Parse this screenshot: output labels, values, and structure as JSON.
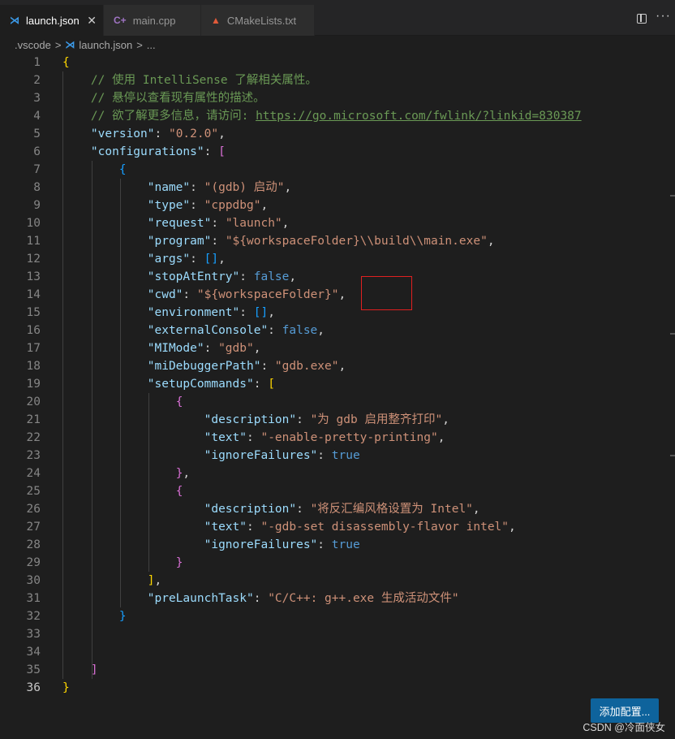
{
  "tabs": [
    {
      "label": "launch.json",
      "icon": "json-icon",
      "active": true,
      "close": "✕"
    },
    {
      "label": "main.cpp",
      "icon": "cpp-icon",
      "active": false
    },
    {
      "label": "CMakeLists.txt",
      "icon": "cmake-icon",
      "active": false
    }
  ],
  "breadcrumb": {
    "folder": ".vscode",
    "sep": ">",
    "file": "launch.json",
    "tail": "..."
  },
  "editor": {
    "line_numbers": [
      "1",
      "2",
      "3",
      "4",
      "5",
      "6",
      "7",
      "8",
      "9",
      "10",
      "11",
      "12",
      "13",
      "14",
      "15",
      "16",
      "17",
      "18",
      "19",
      "20",
      "21",
      "22",
      "23",
      "24",
      "25",
      "26",
      "27",
      "28",
      "29",
      "30",
      "31",
      "32",
      "33",
      "34",
      "35",
      "36"
    ],
    "code": {
      "l2": "// 使用 IntelliSense 了解相关属性。",
      "l3": "// 悬停以查看现有属性的描述。",
      "l4_comment": "// 欲了解更多信息，请访问: ",
      "l4_url": "https://go.microsoft.com/fwlink/?linkid=830387",
      "version_key": "\"version\"",
      "version_val": "\"0.2.0\"",
      "configurations_key": "\"configurations\"",
      "name_key": "\"name\"",
      "name_val": "\"(gdb) 启动\"",
      "type_key": "\"type\"",
      "type_val": "\"cppdbg\"",
      "request_key": "\"request\"",
      "request_val": "\"launch\"",
      "program_key": "\"program\"",
      "program_val": "\"${workspaceFolder}\\\\build\\\\main.exe\"",
      "args_key": "\"args\"",
      "stopAtEntry_key": "\"stopAtEntry\"",
      "stopAtEntry_val": "false",
      "cwd_key": "\"cwd\"",
      "cwd_val": "\"${workspaceFolder}\"",
      "environment_key": "\"environment\"",
      "externalConsole_key": "\"externalConsole\"",
      "externalConsole_val": "false",
      "MIMode_key": "\"MIMode\"",
      "MIMode_val": "\"gdb\"",
      "miDebuggerPath_key": "\"miDebuggerPath\"",
      "miDebuggerPath_val": "\"gdb.exe\"",
      "setupCommands_key": "\"setupCommands\"",
      "desc1_key": "\"description\"",
      "desc1_val": "\"为 gdb 启用整齐打印\"",
      "text1_key": "\"text\"",
      "text1_val": "\"-enable-pretty-printing\"",
      "ignore1_key": "\"ignoreFailures\"",
      "ignore1_val": "true",
      "desc2_key": "\"description\"",
      "desc2_val": "\"将反汇编风格设置为 Intel\"",
      "text2_key": "\"text\"",
      "text2_val": "\"-gdb-set disassembly-flavor intel\"",
      "ignore2_key": "\"ignoreFailures\"",
      "ignore2_val": "true",
      "preLaunchTask_key": "\"preLaunchTask\"",
      "preLaunchTask_val": "\"C/C++: g++.exe 生成活动文件\""
    }
  },
  "add_config_button": "添加配置...",
  "watermark": "CSDN @冷面侠女",
  "colors": {
    "key": "#9cdcfe",
    "string": "#ce9178",
    "comment": "#6a9955",
    "bool": "#569cd6",
    "accent": "#0e639c"
  }
}
